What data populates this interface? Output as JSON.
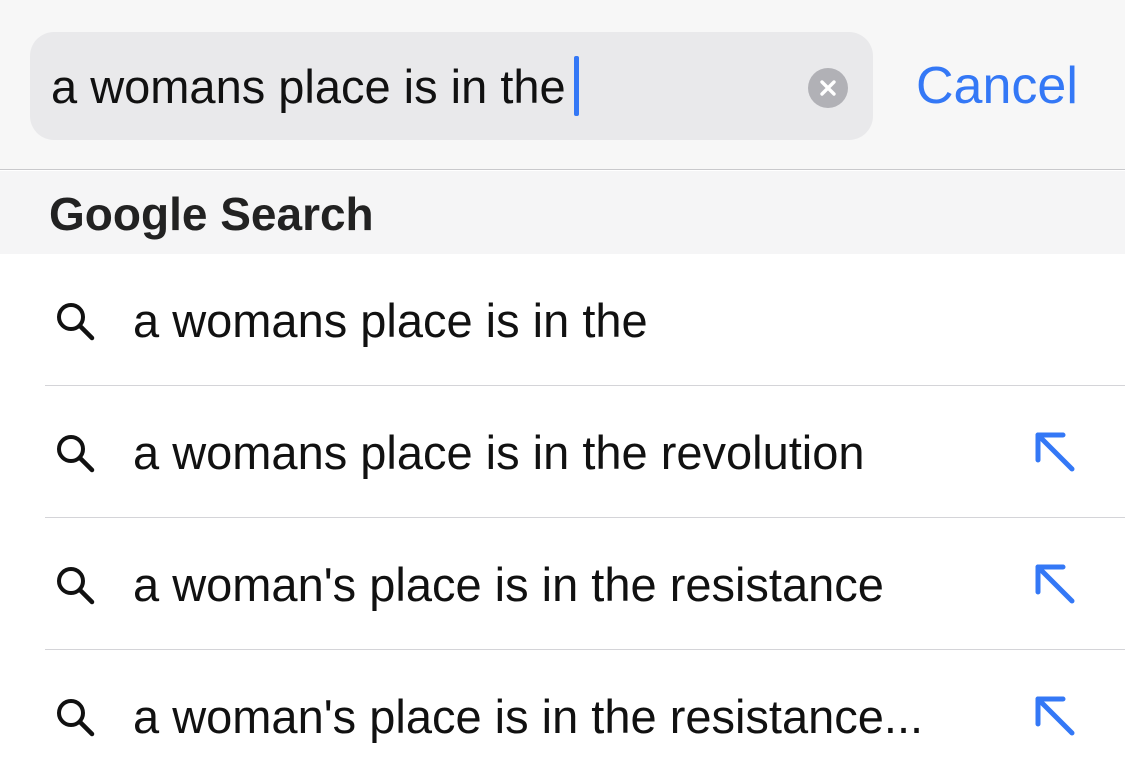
{
  "search": {
    "value": "a womans place is in the",
    "cancel_label": "Cancel"
  },
  "section": {
    "title": "Google Search"
  },
  "suggestions": [
    {
      "label": "a womans place is in the",
      "has_fill_arrow": false
    },
    {
      "label": "a womans place is in the revolution",
      "has_fill_arrow": true
    },
    {
      "label": "a woman's place is in the resistance",
      "has_fill_arrow": true
    },
    {
      "label": "a woman's place is in the resistance...",
      "has_fill_arrow": true
    }
  ],
  "icons": {
    "search": "magnifying-glass",
    "fill": "arrow-up-left",
    "clear": "x-circle"
  },
  "colors": {
    "accent": "#3478f6",
    "field_bg": "#e9e9eb",
    "header_bg": "#f5f5f6"
  }
}
